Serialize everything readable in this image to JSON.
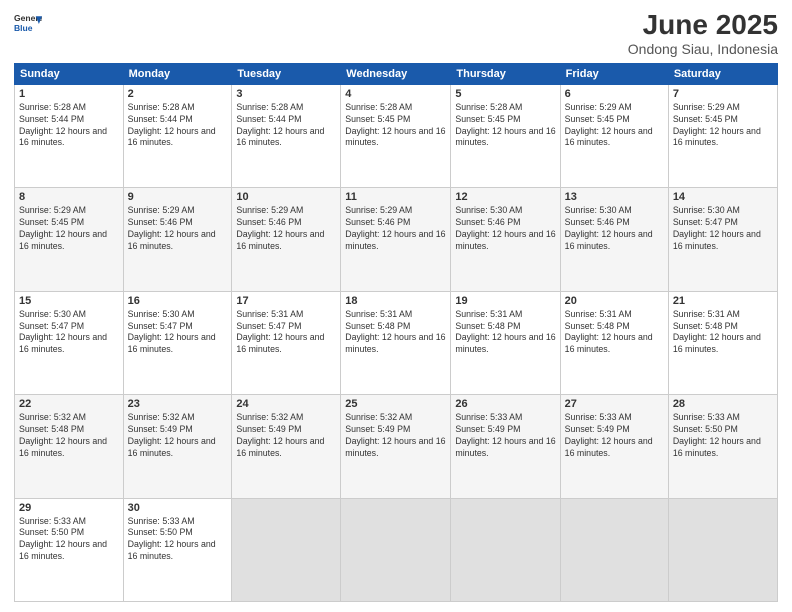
{
  "logo": {
    "general": "General",
    "blue": "Blue"
  },
  "title": "June 2025",
  "subtitle": "Ondong Siau, Indonesia",
  "weekdays": [
    "Sunday",
    "Monday",
    "Tuesday",
    "Wednesday",
    "Thursday",
    "Friday",
    "Saturday"
  ],
  "weeks": [
    [
      {
        "day": "1",
        "sunrise": "5:28 AM",
        "sunset": "5:44 PM",
        "daylight": "12 hours and 16 minutes."
      },
      {
        "day": "2",
        "sunrise": "5:28 AM",
        "sunset": "5:44 PM",
        "daylight": "12 hours and 16 minutes."
      },
      {
        "day": "3",
        "sunrise": "5:28 AM",
        "sunset": "5:44 PM",
        "daylight": "12 hours and 16 minutes."
      },
      {
        "day": "4",
        "sunrise": "5:28 AM",
        "sunset": "5:45 PM",
        "daylight": "12 hours and 16 minutes."
      },
      {
        "day": "5",
        "sunrise": "5:28 AM",
        "sunset": "5:45 PM",
        "daylight": "12 hours and 16 minutes."
      },
      {
        "day": "6",
        "sunrise": "5:29 AM",
        "sunset": "5:45 PM",
        "daylight": "12 hours and 16 minutes."
      },
      {
        "day": "7",
        "sunrise": "5:29 AM",
        "sunset": "5:45 PM",
        "daylight": "12 hours and 16 minutes."
      }
    ],
    [
      {
        "day": "8",
        "sunrise": "5:29 AM",
        "sunset": "5:45 PM",
        "daylight": "12 hours and 16 minutes."
      },
      {
        "day": "9",
        "sunrise": "5:29 AM",
        "sunset": "5:46 PM",
        "daylight": "12 hours and 16 minutes."
      },
      {
        "day": "10",
        "sunrise": "5:29 AM",
        "sunset": "5:46 PM",
        "daylight": "12 hours and 16 minutes."
      },
      {
        "day": "11",
        "sunrise": "5:29 AM",
        "sunset": "5:46 PM",
        "daylight": "12 hours and 16 minutes."
      },
      {
        "day": "12",
        "sunrise": "5:30 AM",
        "sunset": "5:46 PM",
        "daylight": "12 hours and 16 minutes."
      },
      {
        "day": "13",
        "sunrise": "5:30 AM",
        "sunset": "5:46 PM",
        "daylight": "12 hours and 16 minutes."
      },
      {
        "day": "14",
        "sunrise": "5:30 AM",
        "sunset": "5:47 PM",
        "daylight": "12 hours and 16 minutes."
      }
    ],
    [
      {
        "day": "15",
        "sunrise": "5:30 AM",
        "sunset": "5:47 PM",
        "daylight": "12 hours and 16 minutes."
      },
      {
        "day": "16",
        "sunrise": "5:30 AM",
        "sunset": "5:47 PM",
        "daylight": "12 hours and 16 minutes."
      },
      {
        "day": "17",
        "sunrise": "5:31 AM",
        "sunset": "5:47 PM",
        "daylight": "12 hours and 16 minutes."
      },
      {
        "day": "18",
        "sunrise": "5:31 AM",
        "sunset": "5:48 PM",
        "daylight": "12 hours and 16 minutes."
      },
      {
        "day": "19",
        "sunrise": "5:31 AM",
        "sunset": "5:48 PM",
        "daylight": "12 hours and 16 minutes."
      },
      {
        "day": "20",
        "sunrise": "5:31 AM",
        "sunset": "5:48 PM",
        "daylight": "12 hours and 16 minutes."
      },
      {
        "day": "21",
        "sunrise": "5:31 AM",
        "sunset": "5:48 PM",
        "daylight": "12 hours and 16 minutes."
      }
    ],
    [
      {
        "day": "22",
        "sunrise": "5:32 AM",
        "sunset": "5:48 PM",
        "daylight": "12 hours and 16 minutes."
      },
      {
        "day": "23",
        "sunrise": "5:32 AM",
        "sunset": "5:49 PM",
        "daylight": "12 hours and 16 minutes."
      },
      {
        "day": "24",
        "sunrise": "5:32 AM",
        "sunset": "5:49 PM",
        "daylight": "12 hours and 16 minutes."
      },
      {
        "day": "25",
        "sunrise": "5:32 AM",
        "sunset": "5:49 PM",
        "daylight": "12 hours and 16 minutes."
      },
      {
        "day": "26",
        "sunrise": "5:33 AM",
        "sunset": "5:49 PM",
        "daylight": "12 hours and 16 minutes."
      },
      {
        "day": "27",
        "sunrise": "5:33 AM",
        "sunset": "5:49 PM",
        "daylight": "12 hours and 16 minutes."
      },
      {
        "day": "28",
        "sunrise": "5:33 AM",
        "sunset": "5:50 PM",
        "daylight": "12 hours and 16 minutes."
      }
    ],
    [
      {
        "day": "29",
        "sunrise": "5:33 AM",
        "sunset": "5:50 PM",
        "daylight": "12 hours and 16 minutes."
      },
      {
        "day": "30",
        "sunrise": "5:33 AM",
        "sunset": "5:50 PM",
        "daylight": "12 hours and 16 minutes."
      },
      null,
      null,
      null,
      null,
      null
    ]
  ]
}
